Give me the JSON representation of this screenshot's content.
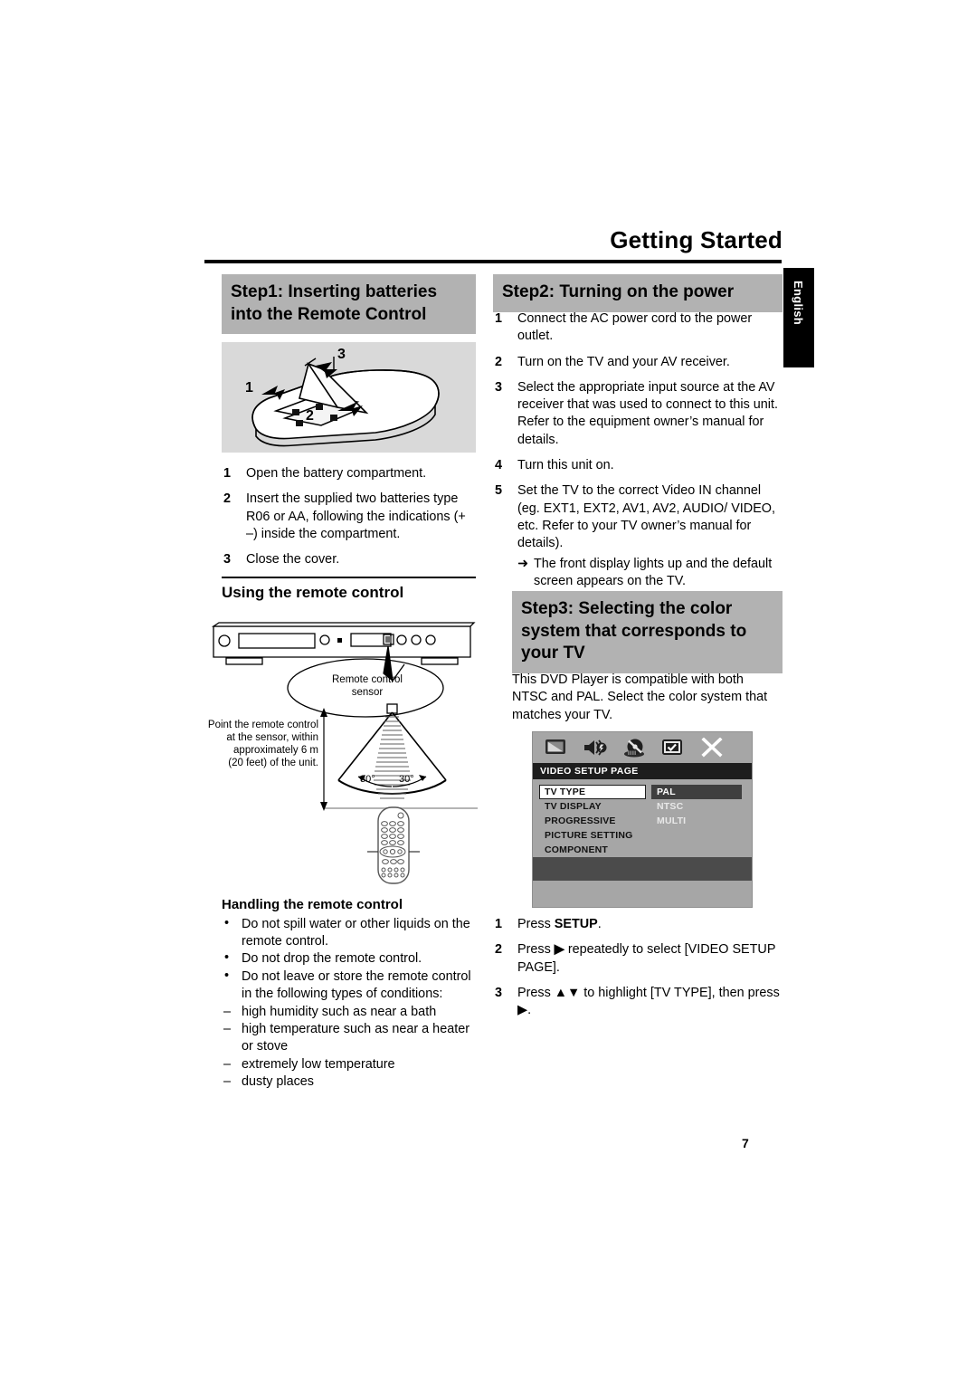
{
  "header": {
    "title": "Getting Started",
    "side_tab": "English"
  },
  "step1": {
    "heading_line1": "Step1: Inserting batteries",
    "heading_line2": "into the Remote Control",
    "figure_labels": [
      "1",
      "2",
      "3"
    ],
    "steps": [
      {
        "n": "1",
        "text": "Open the battery compartment."
      },
      {
        "n": "2",
        "text": "Insert the supplied two batteries type R06 or AA, following the indications (+ –) inside the compartment."
      },
      {
        "n": "3",
        "text": "Close the cover."
      }
    ]
  },
  "step2": {
    "heading": "Step2: Turning on the power",
    "steps": [
      {
        "n": "1",
        "text": "Connect the AC power cord to the power outlet."
      },
      {
        "n": "2",
        "text": "Turn on the TV and your AV receiver."
      },
      {
        "n": "3",
        "text": "Select the appropriate input source at the AV receiver that was used to connect to this unit. Refer to the equipment owner’s manual for details."
      },
      {
        "n": "4",
        "text": "Turn this unit on."
      },
      {
        "n": "5",
        "text": "Set the TV to the correct Video IN channel (eg. EXT1, EXT2, AV1, AV2, AUDIO/ VIDEO, etc. Refer to your TV owner’s manual for details)."
      }
    ],
    "result_arrow": "➜",
    "result_text": "The front display lights up and the default screen appears on the TV."
  },
  "using_remote": {
    "heading": "Using the remote control",
    "sensor_label_line1": "Remote control",
    "sensor_label_line2": "sensor",
    "point_text_lines": [
      "Point the remote control",
      "at the sensor, within",
      "approximately 6 m",
      "(20 feet) of the unit."
    ],
    "angle_left": "30°",
    "angle_right": "30°"
  },
  "handling": {
    "heading": "Handling the remote control",
    "bullets": [
      {
        "marker": "•",
        "text": "Do not spill water or other liquids on the remote control."
      },
      {
        "marker": "•",
        "text": "Do not drop the remote control."
      },
      {
        "marker": "•",
        "text": "Do not leave or store the remote control in the following types of conditions:"
      },
      {
        "marker": "–",
        "text": "high humidity such as near a bath"
      },
      {
        "marker": "–",
        "text": "high temperature such as near a heater or stove"
      },
      {
        "marker": "–",
        "text": "extremely low temperature"
      },
      {
        "marker": "–",
        "text": "dusty places"
      }
    ]
  },
  "step3": {
    "heading_line1": "Step3: Selecting the color",
    "heading_line2": "system that corresponds to",
    "heading_line3": "your TV",
    "intro": "This DVD Player is compatible with both NTSC and PAL. Select the color system that matches your TV.",
    "osd": {
      "icons": [
        "tv-icon",
        "audio-speaker-icon",
        "disc-preference-icon",
        "password-check-icon",
        "exit-x-icon"
      ],
      "page_title": "VIDEO SETUP PAGE",
      "menu_items": [
        "TV TYPE",
        "TV DISPLAY",
        "PROGRESSIVE",
        "PICTURE SETTING",
        "COMPONENT"
      ],
      "selected_menu_item": "TV TYPE",
      "options": [
        "PAL",
        "NTSC",
        "MULTI"
      ],
      "selected_option": "PAL"
    },
    "steps": [
      {
        "n": "1",
        "pre": "Press ",
        "key": "SETUP",
        "post": "."
      },
      {
        "n": "2",
        "pre": "Press ",
        "key": "▶",
        "post": " repeatedly to select [VIDEO SETUP PAGE]."
      },
      {
        "n": "3",
        "pre": "Press ",
        "key": "▲▼",
        "post": " to highlight [TV TYPE], then press ▶."
      }
    ]
  },
  "footer": {
    "page_number": "7"
  }
}
